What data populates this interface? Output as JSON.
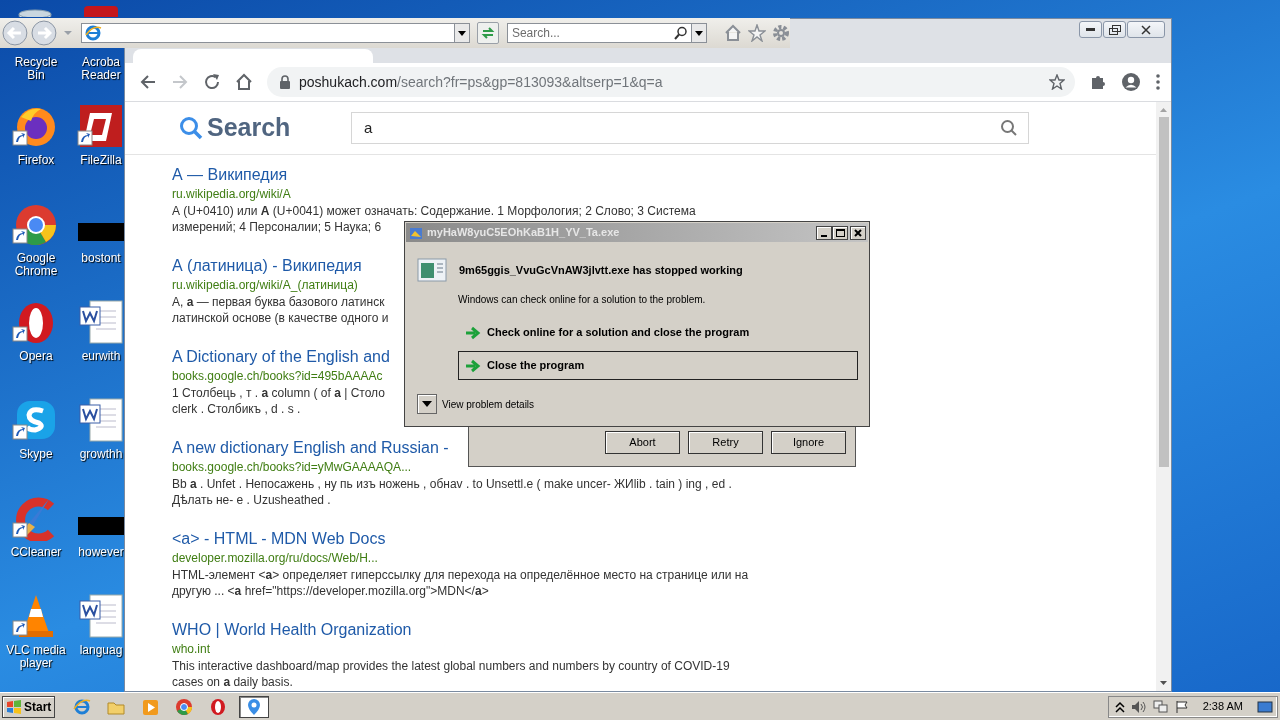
{
  "desktop": {
    "column_1": [
      {
        "kind": "recycle-bin",
        "label": "Recycle Bin"
      },
      {
        "kind": "flame-globe",
        "label": "Firefox"
      },
      {
        "kind": "tri-ring",
        "label": "Google Chrome"
      },
      {
        "kind": "ring",
        "label": "Opera"
      },
      {
        "kind": "bubble",
        "label": "Skype"
      },
      {
        "kind": "brush",
        "label": "CCleaner"
      },
      {
        "kind": "cone",
        "label": "VLC media player"
      }
    ],
    "column_2": [
      {
        "kind": "pdf",
        "label": "Acroba Reader"
      },
      {
        "kind": "app-tile",
        "label": "FileZilla"
      },
      {
        "kind": "redacted",
        "label": "bostont"
      },
      {
        "kind": "document",
        "label": "eurwith"
      },
      {
        "kind": "document",
        "label": "growthh"
      },
      {
        "kind": "redacted",
        "label": "however"
      },
      {
        "kind": "document",
        "label": "languag"
      }
    ]
  },
  "ie_toolbar": {
    "search_placeholder": "Search..."
  },
  "browser": {
    "forward_disabled": true,
    "address": {
      "domain": "poshukach.com",
      "path": "/search?fr=ps&gp=813093&altserp=1&q=a"
    },
    "page": {
      "logo": "Search",
      "query": "a",
      "results": [
        {
          "title": "А — Википедия",
          "url": "ru.wikipedia.org/wiki/A",
          "lines": [
            "А (U+0410) или **A** (U+0041) может означать: Содержание. 1 Морфология; 2 Слово; 3 Система",
            "измерений; 4 Персоналии; 5 Наука; 6"
          ]
        },
        {
          "title": "А (латиница) - Википедия",
          "url": "ru.wikipedia.org/wiki/A_(латиница)",
          "lines": [
            "А, **а** — первая буква базового латинск",
            "латинской основе (в качестве одного и"
          ]
        },
        {
          "title": "A Dictionary of the English and",
          "url": "books.google.ch/books?id=495bAAAAc",
          "lines": [
            "1 Столбець , т . **а** column ( of **a** | Столо",
            "clerk . Столбикъ , d . s ."
          ]
        },
        {
          "title": "A new dictionary English and Russian -",
          "url": "books.google.ch/books?id=yMwGAAAAQA...",
          "lines": [
            "Bb **a** . Unfet . Непосажень , ну пь изъ ножень , обнаv . to Unsettl.e ( make uncer- ЖИlib . tain ) ing , ed .",
            "Дѣлать не- е . Uzusheathed ."
          ]
        },
        {
          "title": "<a> - HTML - MDN Web Docs",
          "url": "developer.mozilla.org/ru/docs/Web/H...",
          "lines": [
            "HTML-элемент <**a**> определяет гиперссылку для перехода на определённое место на странице или на",
            "другую ... <**a** href=\"https://developer.mozilla.org\">MDN</**a**>"
          ]
        },
        {
          "title": "WHO | World Health Organization",
          "url": "who.int",
          "lines": [
            "This interactive dashboard/map provides the latest global numbers and numbers by country of COVID-19",
            "cases on **a** daily basis."
          ]
        }
      ]
    }
  },
  "error_dialog": {
    "title": "myHaW8yuC5EOhKaB1H_YV_Ta.exe",
    "heading": "9m65ggis_VvuGcVnAW3jlvtt.exe has stopped working",
    "message": "Windows can check online for a solution to the problem.",
    "options": [
      {
        "label": "Check online for a solution and close the program",
        "selected": false
      },
      {
        "label": "Close the program",
        "selected": true
      }
    ],
    "details_toggle": "View problem details"
  },
  "abort_dialog": {
    "buttons": [
      "Abort",
      "Retry",
      "Ignore"
    ]
  },
  "taskbar": {
    "start": "Start",
    "apps": [
      {
        "kind": "ie",
        "active": false
      },
      {
        "kind": "folder",
        "active": false
      },
      {
        "kind": "media",
        "active": false
      },
      {
        "kind": "tri-ring",
        "active": false
      },
      {
        "kind": "ring",
        "active": false
      },
      {
        "kind": "pin",
        "active": true
      }
    ],
    "time": "2:38 AM"
  }
}
